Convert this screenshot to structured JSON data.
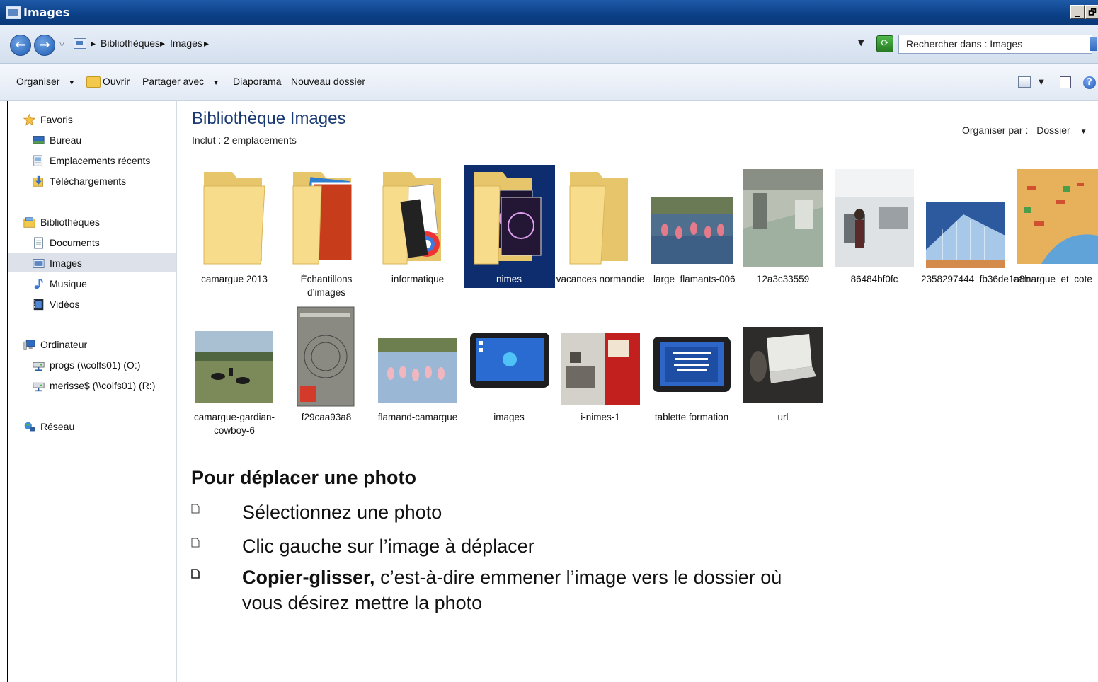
{
  "window": {
    "title": "Images",
    "min_label": "_",
    "max_label": "🗗"
  },
  "address": {
    "crumbs": [
      "Bibliothèques",
      "Images"
    ],
    "search_placeholder": "Rechercher dans : Images"
  },
  "toolbar": {
    "organize": "Organiser",
    "open": "Ouvrir",
    "share": "Partager avec",
    "slideshow": "Diaporama",
    "new_folder": "Nouveau dossier"
  },
  "sidebar": {
    "favorites": "Favoris",
    "fav_items": [
      "Bureau",
      "Emplacements récents",
      "Téléchargements"
    ],
    "libraries": "Bibliothèques",
    "lib_items": [
      "Documents",
      "Images",
      "Musique",
      "Vidéos"
    ],
    "computer": "Ordinateur",
    "computer_items": [
      "progs (\\\\colfs01) (O:)",
      "merisse$ (\\\\colfs01) (R:)"
    ],
    "network": "Réseau"
  },
  "main": {
    "title": "Bibliothèque Images",
    "subtitle": "Inclut : 2 emplacements",
    "arrange_label": "Organiser par :",
    "arrange_value": "Dossier",
    "items": [
      {
        "caption": "camargue 2013",
        "kind": "folder"
      },
      {
        "caption": "Échantillons d’images",
        "kind": "folder-photo"
      },
      {
        "caption": "informatique",
        "kind": "folder-doc"
      },
      {
        "caption": "nimes",
        "kind": "folder-selected"
      },
      {
        "caption": "vacances normandie",
        "kind": "folder"
      },
      {
        "caption": "_large_flamants-006",
        "kind": "photo"
      },
      {
        "caption": "12a3c33559",
        "kind": "photo"
      },
      {
        "caption": "86484bf0fc",
        "kind": "photo"
      },
      {
        "caption": "2358297444_fb36de1a8b",
        "kind": "photo"
      },
      {
        "caption": "camargue_et_cote_du_langued",
        "kind": "photo"
      },
      {
        "caption": "camargue-gardian-cowboy-6",
        "kind": "photo"
      },
      {
        "caption": "f29caa93a8",
        "kind": "photo"
      },
      {
        "caption": "flamand-camargue",
        "kind": "photo"
      },
      {
        "caption": "images",
        "kind": "photo"
      },
      {
        "caption": "i-nimes-1",
        "kind": "photo"
      },
      {
        "caption": "tablette formation",
        "kind": "photo"
      },
      {
        "caption": "url",
        "kind": "photo"
      }
    ]
  },
  "instructions": {
    "heading": "Pour déplacer une photo",
    "steps": [
      {
        "bold": "",
        "text": "Sélectionnez une photo"
      },
      {
        "bold": "",
        "text": "Clic gauche sur l’image à déplacer"
      },
      {
        "bold": "Copier-glisser,",
        "text": " c’est-à-dire emmener l’image vers le dossier où vous désirez mettre la photo"
      }
    ]
  },
  "colors": {
    "titlebar": "#0b3f86",
    "selected_tile": "#0d2d6e",
    "library_title": "#1a3a74"
  }
}
